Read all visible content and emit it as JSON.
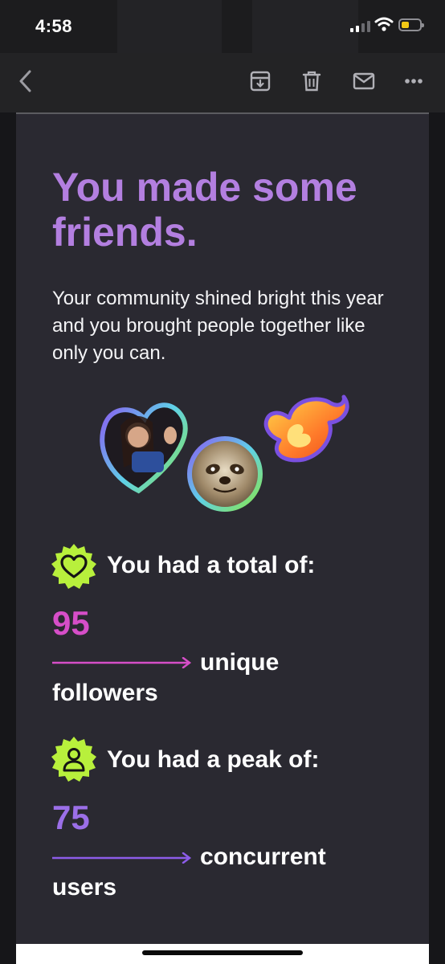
{
  "status_bar": {
    "time": "4:58"
  },
  "toolbar": {
    "back_icon": "chevron-left-icon",
    "actions": [
      "archive-icon",
      "trash-icon",
      "mail-icon",
      "more-icon"
    ]
  },
  "email": {
    "headline": "You made some friends.",
    "paragraph": "Your community shined bright this year and you brought people together like only you can.",
    "stats": [
      {
        "label": "You had a total of:",
        "value": "95",
        "unit": "unique followers",
        "color": "#d64ec8",
        "icon": "heart-badge-icon"
      },
      {
        "label": "You had a peak of:",
        "value": "75",
        "unit": "concurrent users",
        "color": "#9b6fe8",
        "icon": "user-badge-icon"
      }
    ]
  },
  "colors": {
    "headline": "#b37fe0",
    "badge": "#b8f03c",
    "card_bg": "#2a2931"
  }
}
